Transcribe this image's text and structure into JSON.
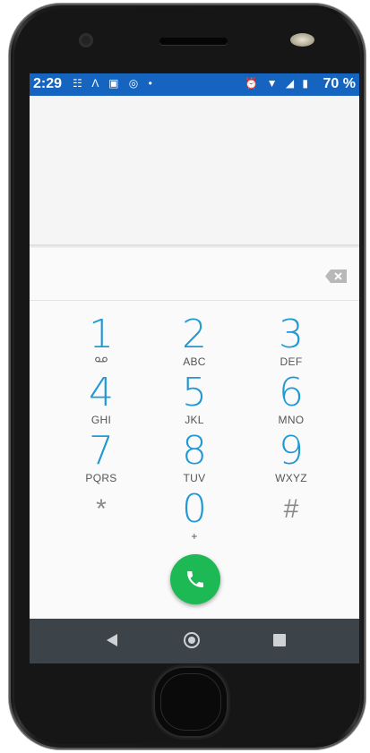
{
  "status_bar": {
    "time": "2:29",
    "left_icons": "☷ Λ ▣ ◎ •",
    "right_icons": "⏰ ▼ ◢ ▮",
    "battery": "70 %"
  },
  "dialer": {
    "entered_digits": "",
    "backspace_icon": "backspace-icon"
  },
  "keypad": {
    "keys": [
      {
        "digit": "1",
        "letters": "",
        "icon": "voicemail-icon"
      },
      {
        "digit": "2",
        "letters": "ABC"
      },
      {
        "digit": "3",
        "letters": "DEF"
      },
      {
        "digit": "4",
        "letters": "GHI"
      },
      {
        "digit": "5",
        "letters": "JKL"
      },
      {
        "digit": "6",
        "letters": "MNO"
      },
      {
        "digit": "7",
        "letters": "PQRS"
      },
      {
        "digit": "8",
        "letters": "TUV"
      },
      {
        "digit": "9",
        "letters": "WXYZ"
      },
      {
        "digit": "*",
        "letters": ""
      },
      {
        "digit": "0",
        "letters": "+"
      },
      {
        "digit": "#",
        "letters": ""
      }
    ]
  },
  "call_button": {
    "icon": "phone-icon",
    "color": "#1db954"
  },
  "nav_bar": {
    "back_icon": "back-icon",
    "home_icon": "home-icon",
    "recents_icon": "recents-icon"
  },
  "colors": {
    "status_bar": "#1565c0",
    "digit": "#1f98d4",
    "nav_bar": "#3d4449"
  }
}
